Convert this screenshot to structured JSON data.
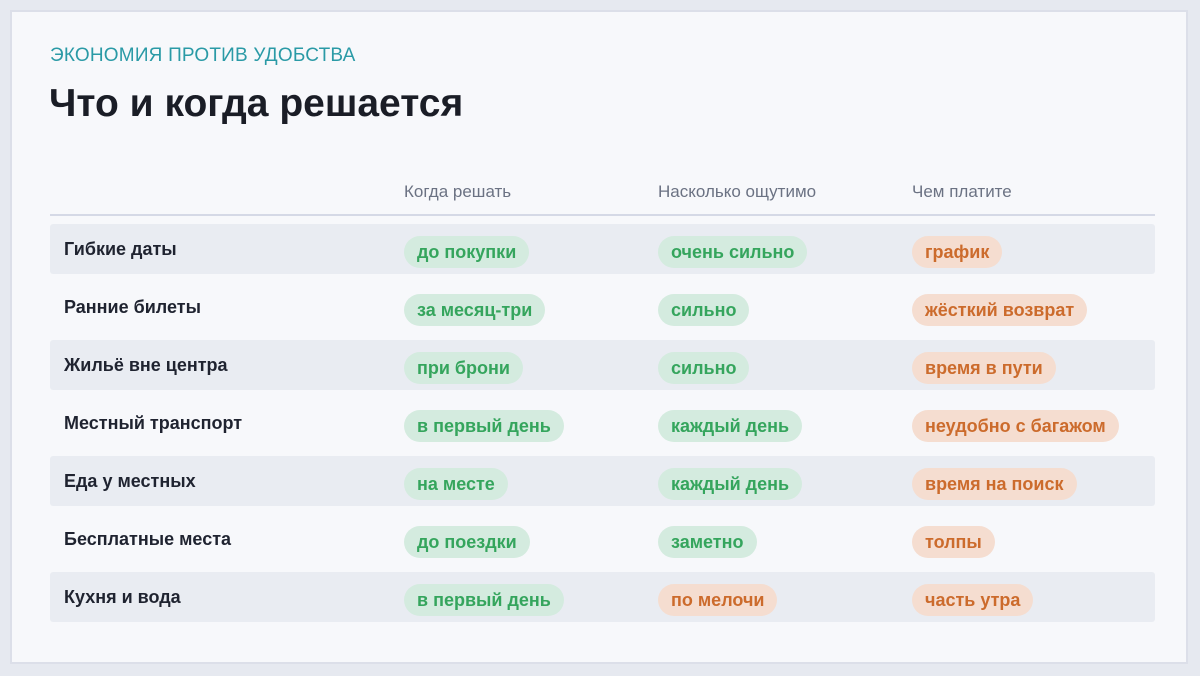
{
  "header": {
    "eyebrow": "ЭКОНОМИЯ ПРОТИВ УДОБСТВА",
    "title": "Что и когда решается"
  },
  "colors": {
    "accent": "#2a9aa6",
    "positive_text": "#35a55d",
    "positive_bg": "#d4ebdf",
    "cost_text": "#cc6b2c",
    "cost_bg": "#f5ddd0"
  },
  "table": {
    "columns": [
      "",
      "Когда решать",
      "Насколько ощутимо",
      "Чем платите"
    ],
    "rows": [
      {
        "label": "Гибкие даты",
        "when": "до покупки",
        "impact": "очень сильно",
        "impact_tone": "green",
        "cost": "график"
      },
      {
        "label": "Ранние билеты",
        "when": "за месяц-три",
        "impact": "сильно",
        "impact_tone": "green",
        "cost": "жёсткий возврат"
      },
      {
        "label": "Жильё вне центра",
        "when": "при брони",
        "impact": "сильно",
        "impact_tone": "green",
        "cost": "время в пути"
      },
      {
        "label": "Местный транспорт",
        "when": "в первый день",
        "impact": "каждый день",
        "impact_tone": "green",
        "cost": "неудобно с багажом"
      },
      {
        "label": "Еда у местных",
        "when": "на месте",
        "impact": "каждый день",
        "impact_tone": "green",
        "cost": "время на поиск"
      },
      {
        "label": "Бесплатные места",
        "when": "до поездки",
        "impact": "заметно",
        "impact_tone": "green",
        "cost": "толпы"
      },
      {
        "label": "Кухня и вода",
        "when": "в первый день",
        "impact": "по мелочи",
        "impact_tone": "orange",
        "cost": "часть утра"
      }
    ]
  }
}
